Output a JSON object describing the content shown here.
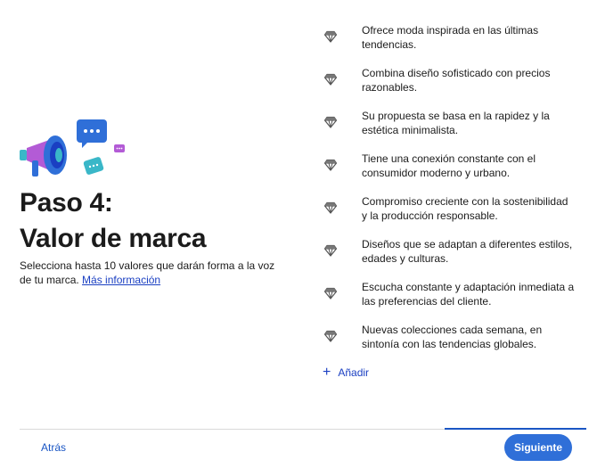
{
  "step": {
    "title_line1": "Paso 4:",
    "title_line2": "Valor de marca",
    "description": "Selecciona hasta 10 valores que darán forma a la voz de tu marca.",
    "more_link": "Más información"
  },
  "values": [
    {
      "icon": "diamond-icon",
      "text": "Ofrece moda inspirada en las últimas tendencias."
    },
    {
      "icon": "diamond-icon",
      "text": "Combina diseño sofisticado con precios razonables."
    },
    {
      "icon": "diamond-icon",
      "text": "Su propuesta se basa en la rapidez y la estética minimalista."
    },
    {
      "icon": "diamond-icon",
      "text": "Tiene una conexión constante con el consumidor moderno y urbano."
    },
    {
      "icon": "diamond-icon",
      "text": "Compromiso creciente con la sostenibilidad y la producción responsable."
    },
    {
      "icon": "diamond-icon",
      "text": "Diseños que se adaptan a diferentes estilos, edades y culturas."
    },
    {
      "icon": "diamond-icon",
      "text": "Escucha constante y adaptación inmediata a las preferencias del cliente."
    },
    {
      "icon": "diamond-icon",
      "text": "Nuevas colecciones cada semana, en sintonía con las tendencias globales."
    }
  ],
  "add_label": "Añadir",
  "footer": {
    "back_label": "Atrás",
    "next_label": "Siguiente"
  },
  "colors": {
    "accent": "#1a56c4",
    "button": "#2f6fd8",
    "illustration_blue": "#2f6fd8",
    "illustration_purple": "#b35bd6",
    "illustration_teal": "#3ab7c8"
  },
  "progress_fraction": 0.25
}
